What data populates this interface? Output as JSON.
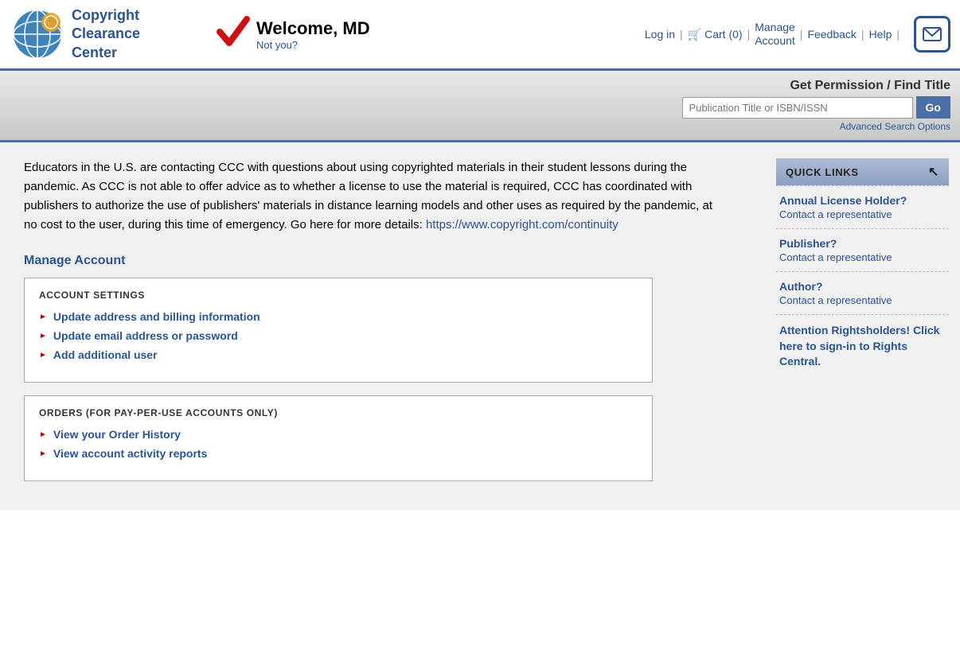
{
  "header": {
    "logo_line1": "Copyright",
    "logo_line2": "Clearance",
    "logo_line3": "Center",
    "welcome_title": "Welcome, MD",
    "not_you": "Not you?",
    "login_label": "Log in",
    "cart_label": "Cart (0)",
    "manage_label": "Manage",
    "manage_label2": "Account",
    "feedback_label": "Feedback",
    "help_label": "Help"
  },
  "search": {
    "label": "Get Permission / Find Title",
    "placeholder": "Publication Title or ISBN/ISSN",
    "go_label": "Go",
    "advanced_label": "Advanced Search Options"
  },
  "pandemic_notice": "Educators in the U.S. are contacting CCC with questions about using copyrighted materials in their student lessons during the pandemic. As CCC is not able to offer advice as to whether a license to use the material is required, CCC has coordinated with publishers to authorize the use of publishers' materials in distance learning models and other uses as required by the pandemic, at no cost to the user, during this time of emergency. Go here for more details: https://www.copyright.com/continuity",
  "manage_account": {
    "heading": "Manage Account",
    "account_settings": {
      "title": "ACCOUNT SETTINGS",
      "links": [
        "Update address and billing information",
        "Update email address or password",
        "Add additional user"
      ]
    },
    "orders": {
      "title": "ORDERS (FOR PAY-PER-USE ACCOUNTS ONLY)",
      "links": [
        "View your Order History",
        "View account activity reports"
      ]
    }
  },
  "sidebar": {
    "quick_links_label": "QUICK LINKS",
    "sections": [
      {
        "title": "Annual License Holder?",
        "sub": "Contact a representative"
      },
      {
        "title": "Publisher?",
        "sub": "Contact a representative"
      },
      {
        "title": "Author?",
        "sub": "Contact a representative"
      },
      {
        "title": "Attention Rightsholders! Click here to sign-in to Rights Central.",
        "sub": ""
      }
    ]
  }
}
